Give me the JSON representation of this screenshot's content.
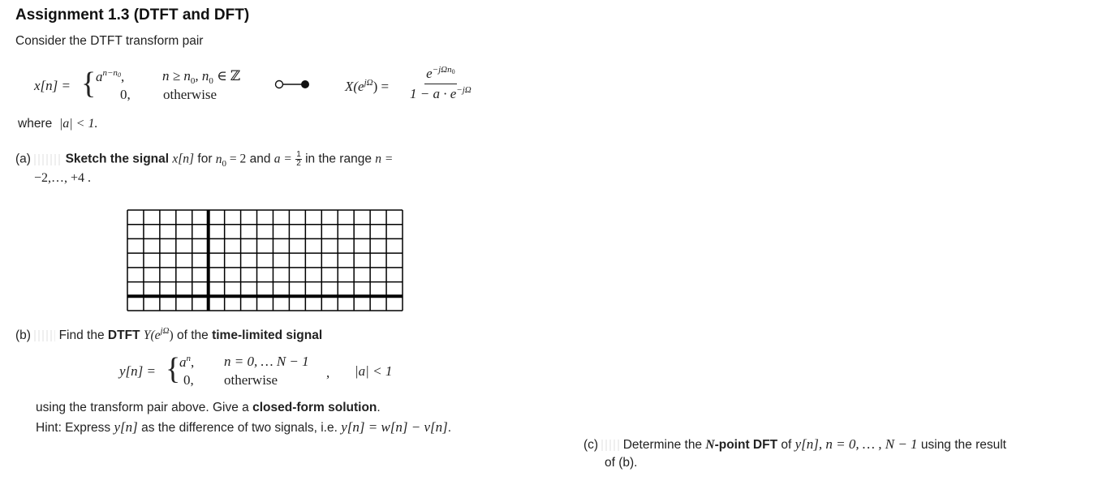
{
  "title": "Assignment 1.3 (DTFT and DFT)",
  "intro": "Consider the DTFT transform pair",
  "transform_pair": {
    "lhs": "x[n] =",
    "case1_expr": "a",
    "case1_exp": "n−n",
    "case1_exp_sub": "0",
    "case1_comma": ",",
    "case1_cond": "n ≥ n",
    "case1_cond_sub": "0",
    "case1_cond_rest": ", n",
    "case1_cond_sub2": "0",
    "case1_cond_set": " ∈ ℤ",
    "case2_expr": "0,",
    "case2_cond": "otherwise",
    "symbol": "o—●",
    "rhs_lhs": "X(e",
    "rhs_lhs_sup": "jΩ",
    "rhs_lhs_close": ") =",
    "rhs_num": "e",
    "rhs_num_sup": "−jΩn",
    "rhs_num_sup_sub": "0",
    "rhs_den": "1 − a · e",
    "rhs_den_sup": "−jΩ"
  },
  "where": {
    "label": "where",
    "cond": "|a| < 1."
  },
  "part_a": {
    "label": "(a)",
    "bold": "Sketch the signal",
    "sig": "x[n]",
    "for": "for",
    "n0": "n",
    "n0_sub": "0",
    "n0_val": " = 2",
    "and": "and",
    "a_eq": "a =",
    "frac_num": "1",
    "frac_den": "2",
    "range_text": "in the range",
    "n_eq": "n =",
    "range": "−2,…, +4 ."
  },
  "sketch_grid": {
    "columns": 17,
    "rows": 7,
    "vertical_axis_after_column": 5,
    "horizontal_axis_above_row": 7
  },
  "part_b": {
    "label": "(b)",
    "find": "Find the",
    "dtft": "DTFT",
    "Y": "Y(e",
    "Y_sup": "jΩ",
    "Y_close": ")",
    "of_the": "of the",
    "bold2": "time-limited signal",
    "lhs": "y[n] =",
    "case1_expr": "a",
    "case1_sup": "n",
    "case1_comma": ",",
    "case1_cond": "n = 0, … N − 1",
    "case2_expr": "0,",
    "case2_cond": "otherwise",
    "trailing_comma": ",",
    "cond": "|a| < 1",
    "line1_pre": "using the transform pair above. Give a",
    "line1_bold": "closed-form solution",
    "line1_post": ".",
    "hint_pre": "Hint: Express",
    "hint_y": "y[n]",
    "hint_mid": "as the difference of two signals, i.e.",
    "hint_eq": "y[n] = w[n] − v[n]",
    "hint_post": "."
  },
  "part_c": {
    "label": "(c)",
    "pre": "Determine the",
    "N": "N",
    "bold": "-point DFT",
    "of": "of",
    "y": "y[n]",
    "range": ", n = 0, … , N − 1",
    "post": "using the result",
    "line2": "of (b)."
  }
}
